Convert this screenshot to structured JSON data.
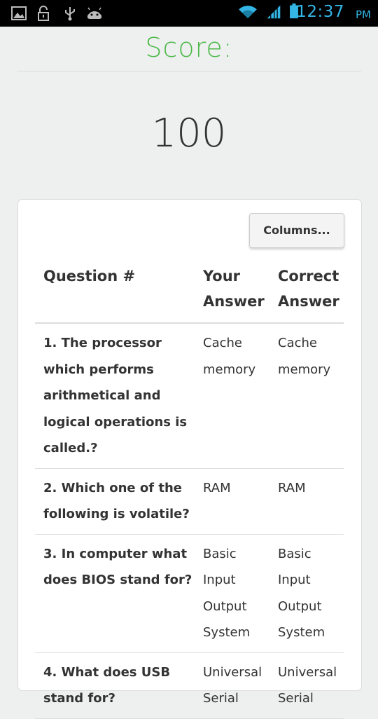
{
  "status_bar": {
    "time": "12:37",
    "ampm": "PM",
    "icons": [
      "picture-icon",
      "lock-icon",
      "usb-icon",
      "android-icon",
      "wifi-icon",
      "signal-icon",
      "battery-icon"
    ]
  },
  "score": {
    "title": "Score:",
    "value": "100"
  },
  "columns_button": "Columns...",
  "table": {
    "headers": [
      "Question #",
      "Your Answer",
      "Correct Answer"
    ],
    "rows": [
      {
        "question": "1. The processor which performs arithmetical and logical operations is called.?",
        "your_answer": "Cache memory",
        "correct_answer": "Cache memory"
      },
      {
        "question": "2. Which one of the following is volatile?",
        "your_answer": "RAM",
        "correct_answer": "RAM"
      },
      {
        "question": "3. In computer what does BIOS stand for?",
        "your_answer": "Basic Input Output System",
        "correct_answer": "Basic Input Output System"
      },
      {
        "question": "4. What does USB stand for?",
        "your_answer": "Universal Serial",
        "correct_answer": "Universal Serial"
      }
    ]
  },
  "colors": {
    "accent_green": "#4cb848",
    "status_blue": "#33b5e5",
    "background": "#eef0f0"
  }
}
